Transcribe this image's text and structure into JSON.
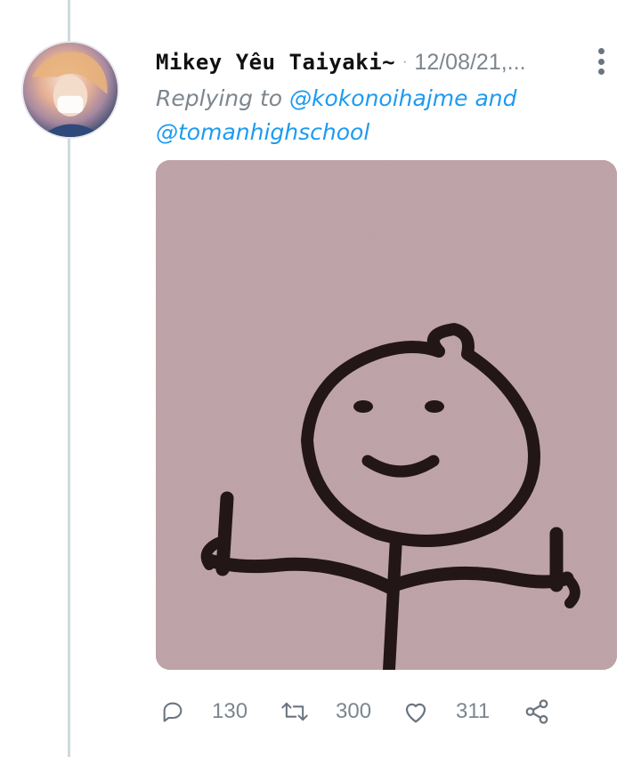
{
  "tweet": {
    "display_name": "Mikey Yêu Taiyaki~",
    "separator": "·",
    "timestamp": "12/08/21,...",
    "reply_prefix": "Replying to",
    "mention_1": "@kokonoihajme",
    "reply_joiner": "and",
    "mention_2": "@tomanhighschool"
  },
  "actions": {
    "replies": "130",
    "retweets": "300",
    "likes": "311"
  },
  "icons": {
    "reply": "reply-icon",
    "retweet": "retweet-icon",
    "like": "heart-icon",
    "share": "share-icon",
    "more": "more-vertical-icon"
  },
  "colors": {
    "mention": "#1d9bf0",
    "muted": "#7d868e",
    "thread_line": "#cfd9de"
  }
}
